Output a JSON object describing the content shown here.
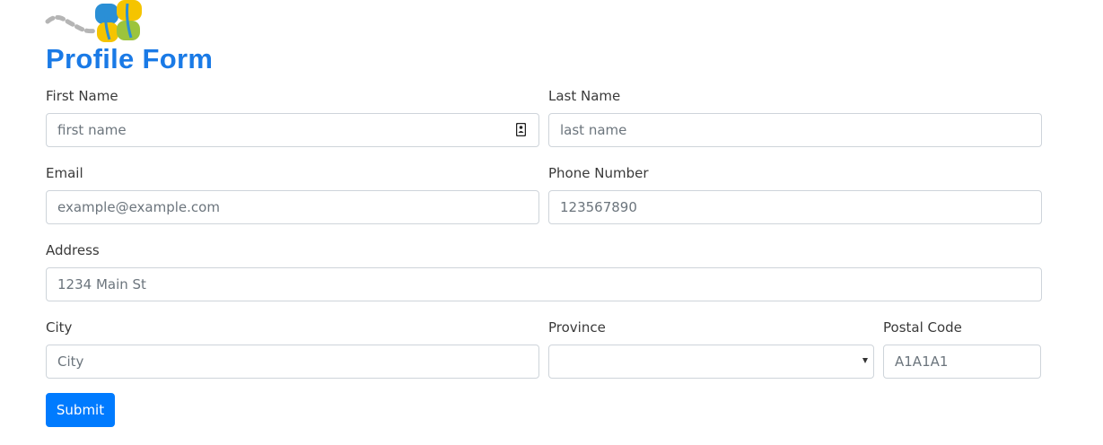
{
  "header": {
    "title": "Profile Form",
    "logo_icon": "butterfly-logo-icon"
  },
  "form": {
    "first_name": {
      "label": "First Name",
      "placeholder": "first name",
      "icon": "contact-card-icon"
    },
    "last_name": {
      "label": "Last Name",
      "placeholder": "last name"
    },
    "email": {
      "label": "Email",
      "placeholder": "example@example.com"
    },
    "phone": {
      "label": "Phone Number",
      "placeholder": "123567890"
    },
    "address": {
      "label": "Address",
      "placeholder": "1234 Main St"
    },
    "city": {
      "label": "City",
      "placeholder": "City"
    },
    "province": {
      "label": "Province",
      "value": "",
      "icon": "chevron-down-icon"
    },
    "postal_code": {
      "label": "Postal Code",
      "placeholder": "A1A1A1"
    },
    "submit_label": "Submit"
  },
  "colors": {
    "accent": "#007bff",
    "title": "#1a7ae6",
    "logo_yellow": "#f5c400",
    "logo_blue": "#2a8fd6",
    "logo_green": "#9cc43c",
    "logo_gray": "#b5b5b5"
  }
}
